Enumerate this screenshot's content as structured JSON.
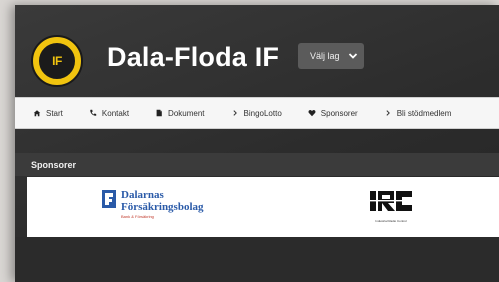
{
  "header": {
    "logo_text": "IF",
    "site_title": "Dala-Floda IF",
    "team_select": {
      "label": "Välj lag",
      "icon": "chevron-down-icon"
    }
  },
  "nav": {
    "items": [
      {
        "label": "Start",
        "icon": "home-icon"
      },
      {
        "label": "Kontakt",
        "icon": "phone-icon"
      },
      {
        "label": "Dokument",
        "icon": "document-icon"
      },
      {
        "label": "BingoLotto",
        "icon": "chevron-right-icon"
      },
      {
        "label": "Sponsorer",
        "icon": "heart-icon"
      },
      {
        "label": "Bli stödmedlem",
        "icon": "chevron-right-icon"
      }
    ]
  },
  "sponsors": {
    "title": "Sponsorer",
    "items": [
      {
        "name_line1": "Dalarnas",
        "name_line2": "Försäkringsbolag",
        "tagline": "Bank & Försäkring"
      },
      {
        "mark": "IRC",
        "caption": "Industrial Radio Control"
      }
    ]
  },
  "colors": {
    "accent_yellow": "#f1c40f",
    "link_blue": "#2a5aa8",
    "header_bg": "#333333"
  }
}
